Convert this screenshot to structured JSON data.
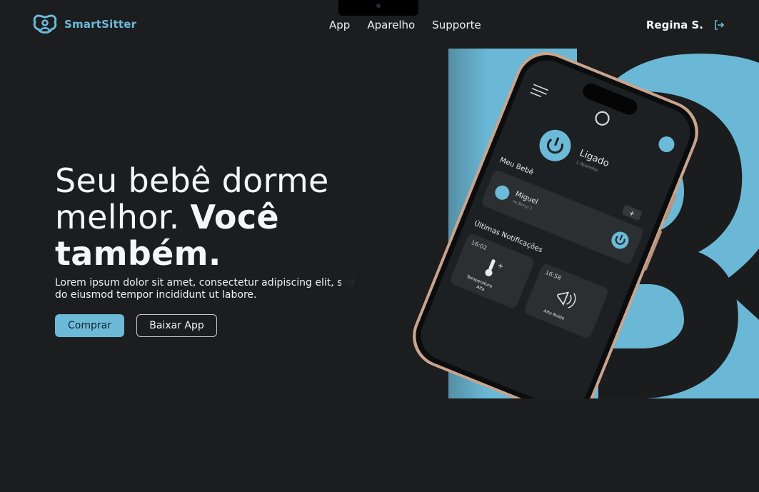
{
  "brand": {
    "name": "SmartSitter",
    "accent": "#6cbad8",
    "background": "#1b1d1f"
  },
  "nav": {
    "items": [
      "App",
      "Aparelho",
      "Supporte"
    ]
  },
  "user": {
    "name": "Regina S.",
    "logout_icon": "logout-icon"
  },
  "hero": {
    "title_light": "Seu bebê dorme melhor.",
    "title_strong_1": "Você",
    "title_strong_2": "também.",
    "subtitle": "Lorem ipsum dolor sit amet, consectetur adipiscing elit, sed do eiusmod tempor incididunt ut labore.",
    "primary_button": "Comprar",
    "secondary_button": "Baixar App"
  },
  "phone": {
    "status": "Ligado",
    "status_sub": "1 Aparelho",
    "section_baby": "Meu Bebê",
    "add_label": "+",
    "baby_name": "Miguel",
    "baby_location": "no Berço 1",
    "section_notifications": "Últimas Notificações",
    "notifications": [
      {
        "time": "16:02",
        "label_1": "Temperatura",
        "label_2": "Alta",
        "icon": "thermometer-icon"
      },
      {
        "time": "16:58",
        "label_1": "Alto Ruído",
        "label_2": "",
        "icon": "megaphone-icon"
      }
    ]
  }
}
